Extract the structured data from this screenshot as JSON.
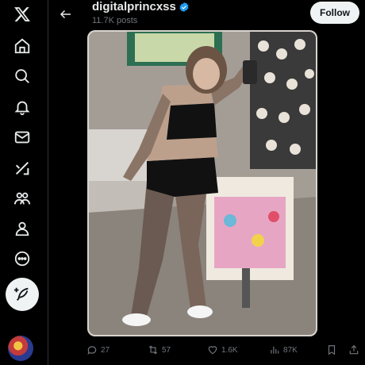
{
  "nav": {
    "items": [
      {
        "name": "x-logo-icon"
      },
      {
        "name": "home-icon"
      },
      {
        "name": "search-icon"
      },
      {
        "name": "notifications-icon"
      },
      {
        "name": "messages-icon"
      },
      {
        "name": "grok-icon"
      },
      {
        "name": "communities-icon"
      },
      {
        "name": "profile-icon"
      },
      {
        "name": "more-icon"
      }
    ],
    "post_button_icon": "feather-plus-icon"
  },
  "header": {
    "username": "digitalprincxss",
    "posts_count": "11.7K posts",
    "follow_label": "Follow"
  },
  "actions": {
    "replies": "27",
    "reposts": "57",
    "likes": "1.6K",
    "views": "87K"
  },
  "colors": {
    "background": "#000000",
    "verified": "#1d9bf0",
    "follow_bg": "#eff3f4",
    "muted": "#71767b"
  }
}
